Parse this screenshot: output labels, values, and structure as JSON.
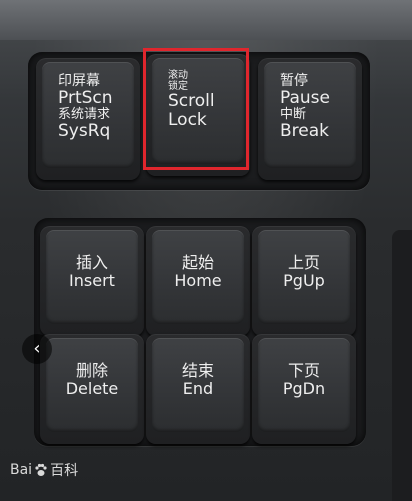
{
  "keys": {
    "prtscn": {
      "line1": "印屏幕",
      "line2": "PrtScn",
      "line3": "系统请求",
      "line4": "SysRq"
    },
    "scroll_lock": {
      "line1": "滚动",
      "line2": "锁定",
      "line3": "Scroll",
      "line4": "Lock"
    },
    "pause": {
      "line1": "暂停",
      "line2": "Pause",
      "line3": "中断",
      "line4": "Break"
    },
    "insert": {
      "cn": "插入",
      "en": "Insert"
    },
    "home": {
      "cn": "起始",
      "en": "Home"
    },
    "pgup": {
      "cn": "上页",
      "en": "PgUp"
    },
    "delete": {
      "cn": "删除",
      "en": "Delete"
    },
    "end": {
      "cn": "结束",
      "en": "End"
    },
    "pgdn": {
      "cn": "下页",
      "en": "PgDn"
    }
  },
  "highlight_color": "#e0262d",
  "nav": {
    "prev_glyph": "‹"
  },
  "watermark": {
    "brand_left": "Bai",
    "brand_right": "百科"
  }
}
